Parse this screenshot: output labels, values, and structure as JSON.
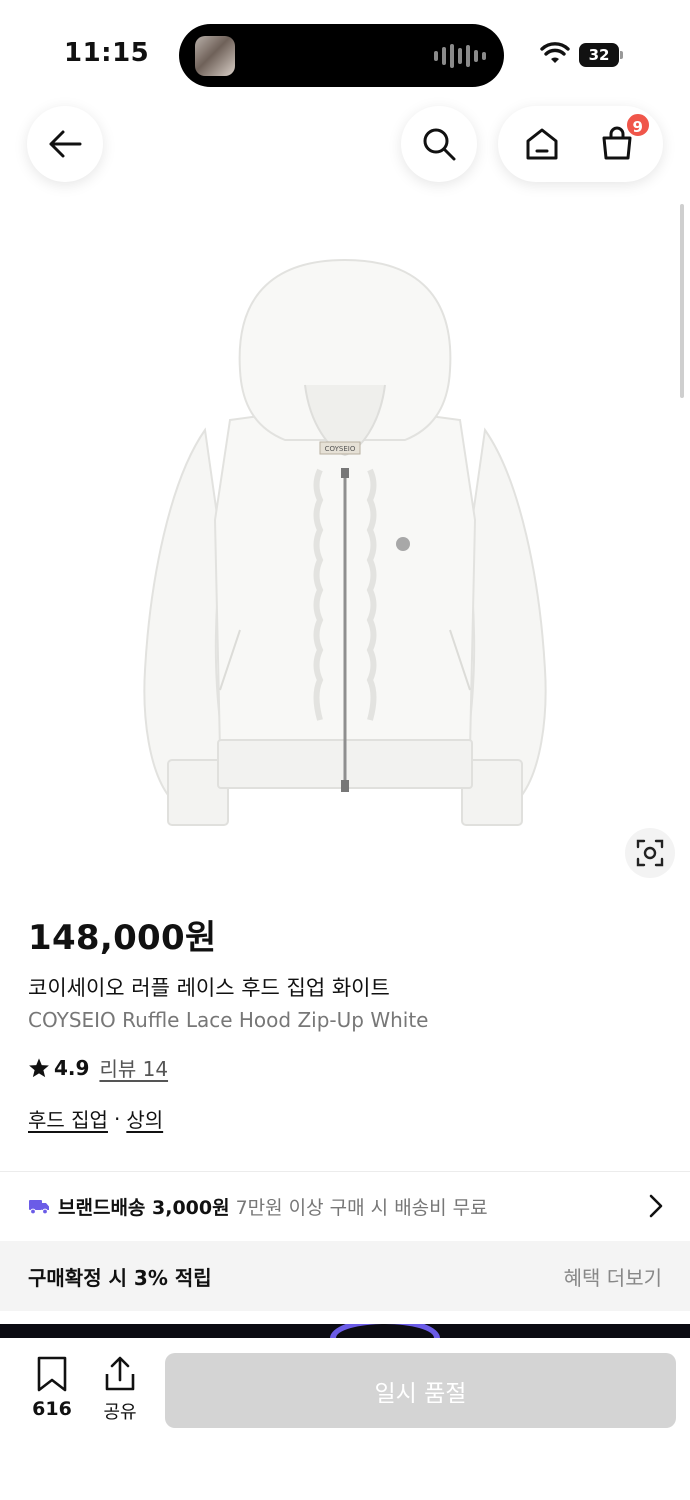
{
  "status_bar": {
    "time": "11:15",
    "battery": "32"
  },
  "nav": {
    "cart_badge": "9"
  },
  "product": {
    "price": "148,000원",
    "name_ko": "코이세이오 러플 레이스 후드 집업 화이트",
    "name_en": "COYSEIO Ruffle Lace Hood Zip-Up White",
    "rating": "4.9",
    "review_label": "리뷰 14",
    "categories": [
      "후드 집업",
      "상의"
    ],
    "category_separator": "·",
    "label_tag": "COYSEIO"
  },
  "shipping": {
    "title": "브랜드배송 3,000원",
    "description": "7만원 이상 구매 시 배송비 무료",
    "accent_color": "#6b5ce7"
  },
  "benefit": {
    "text": "구매확정 시 3% 적립",
    "more_label": "혜택 더보기"
  },
  "bottom_bar": {
    "bookmark_count": "616",
    "share_label": "공유",
    "buy_button_label": "일시 품절"
  },
  "icons": [
    "back-arrow-icon",
    "search-icon",
    "home-icon",
    "cart-icon",
    "lens-search-icon",
    "truck-icon",
    "chevron-right-icon",
    "bookmark-icon",
    "share-icon",
    "wifi-icon",
    "star-icon"
  ]
}
